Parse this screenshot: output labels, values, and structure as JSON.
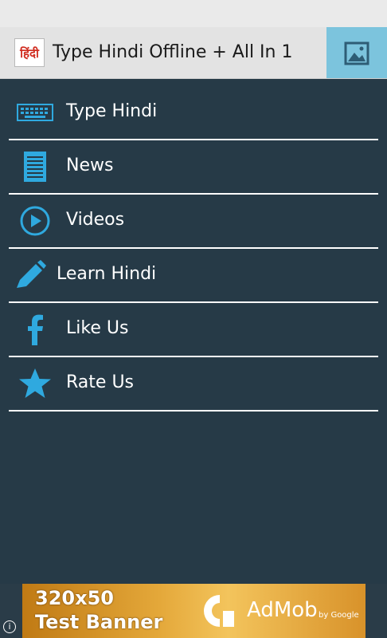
{
  "app_bar": {
    "logo_text": "हिंदी",
    "title": "Type Hindi Offline + All In 1",
    "action_icon": "image-icon",
    "action_color": "#7cc4dd"
  },
  "menu": {
    "items": [
      {
        "label": "Type Hindi",
        "icon": "keyboard-icon"
      },
      {
        "label": "News",
        "icon": "document-icon"
      },
      {
        "label": "Videos",
        "icon": "play-icon"
      },
      {
        "label": "Learn Hindi",
        "icon": "pencil-icon"
      },
      {
        "label": "Like Us",
        "icon": "facebook-icon"
      },
      {
        "label": "Rate Us",
        "icon": "star-icon"
      }
    ],
    "icon_color": "#2fa9df",
    "background": "#263a47"
  },
  "ad_banner": {
    "line1": "320x50",
    "line2": "Test Banner",
    "brand": "AdMob",
    "by": "by Google",
    "info": "i"
  }
}
